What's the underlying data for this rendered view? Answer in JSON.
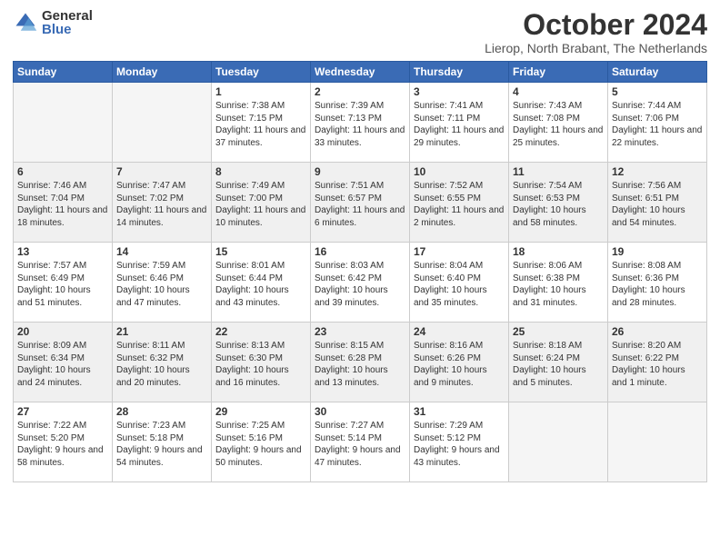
{
  "logo": {
    "general": "General",
    "blue": "Blue"
  },
  "header": {
    "month": "October 2024",
    "location": "Lierop, North Brabant, The Netherlands"
  },
  "days_of_week": [
    "Sunday",
    "Monday",
    "Tuesday",
    "Wednesday",
    "Thursday",
    "Friday",
    "Saturday"
  ],
  "weeks": [
    [
      {
        "num": "",
        "sunrise": "",
        "sunset": "",
        "daylight": "",
        "empty": true
      },
      {
        "num": "",
        "sunrise": "",
        "sunset": "",
        "daylight": "",
        "empty": true
      },
      {
        "num": "1",
        "sunrise": "Sunrise: 7:38 AM",
        "sunset": "Sunset: 7:15 PM",
        "daylight": "Daylight: 11 hours and 37 minutes.",
        "empty": false
      },
      {
        "num": "2",
        "sunrise": "Sunrise: 7:39 AM",
        "sunset": "Sunset: 7:13 PM",
        "daylight": "Daylight: 11 hours and 33 minutes.",
        "empty": false
      },
      {
        "num": "3",
        "sunrise": "Sunrise: 7:41 AM",
        "sunset": "Sunset: 7:11 PM",
        "daylight": "Daylight: 11 hours and 29 minutes.",
        "empty": false
      },
      {
        "num": "4",
        "sunrise": "Sunrise: 7:43 AM",
        "sunset": "Sunset: 7:08 PM",
        "daylight": "Daylight: 11 hours and 25 minutes.",
        "empty": false
      },
      {
        "num": "5",
        "sunrise": "Sunrise: 7:44 AM",
        "sunset": "Sunset: 7:06 PM",
        "daylight": "Daylight: 11 hours and 22 minutes.",
        "empty": false
      }
    ],
    [
      {
        "num": "6",
        "sunrise": "Sunrise: 7:46 AM",
        "sunset": "Sunset: 7:04 PM",
        "daylight": "Daylight: 11 hours and 18 minutes.",
        "empty": false
      },
      {
        "num": "7",
        "sunrise": "Sunrise: 7:47 AM",
        "sunset": "Sunset: 7:02 PM",
        "daylight": "Daylight: 11 hours and 14 minutes.",
        "empty": false
      },
      {
        "num": "8",
        "sunrise": "Sunrise: 7:49 AM",
        "sunset": "Sunset: 7:00 PM",
        "daylight": "Daylight: 11 hours and 10 minutes.",
        "empty": false
      },
      {
        "num": "9",
        "sunrise": "Sunrise: 7:51 AM",
        "sunset": "Sunset: 6:57 PM",
        "daylight": "Daylight: 11 hours and 6 minutes.",
        "empty": false
      },
      {
        "num": "10",
        "sunrise": "Sunrise: 7:52 AM",
        "sunset": "Sunset: 6:55 PM",
        "daylight": "Daylight: 11 hours and 2 minutes.",
        "empty": false
      },
      {
        "num": "11",
        "sunrise": "Sunrise: 7:54 AM",
        "sunset": "Sunset: 6:53 PM",
        "daylight": "Daylight: 10 hours and 58 minutes.",
        "empty": false
      },
      {
        "num": "12",
        "sunrise": "Sunrise: 7:56 AM",
        "sunset": "Sunset: 6:51 PM",
        "daylight": "Daylight: 10 hours and 54 minutes.",
        "empty": false
      }
    ],
    [
      {
        "num": "13",
        "sunrise": "Sunrise: 7:57 AM",
        "sunset": "Sunset: 6:49 PM",
        "daylight": "Daylight: 10 hours and 51 minutes.",
        "empty": false
      },
      {
        "num": "14",
        "sunrise": "Sunrise: 7:59 AM",
        "sunset": "Sunset: 6:46 PM",
        "daylight": "Daylight: 10 hours and 47 minutes.",
        "empty": false
      },
      {
        "num": "15",
        "sunrise": "Sunrise: 8:01 AM",
        "sunset": "Sunset: 6:44 PM",
        "daylight": "Daylight: 10 hours and 43 minutes.",
        "empty": false
      },
      {
        "num": "16",
        "sunrise": "Sunrise: 8:03 AM",
        "sunset": "Sunset: 6:42 PM",
        "daylight": "Daylight: 10 hours and 39 minutes.",
        "empty": false
      },
      {
        "num": "17",
        "sunrise": "Sunrise: 8:04 AM",
        "sunset": "Sunset: 6:40 PM",
        "daylight": "Daylight: 10 hours and 35 minutes.",
        "empty": false
      },
      {
        "num": "18",
        "sunrise": "Sunrise: 8:06 AM",
        "sunset": "Sunset: 6:38 PM",
        "daylight": "Daylight: 10 hours and 31 minutes.",
        "empty": false
      },
      {
        "num": "19",
        "sunrise": "Sunrise: 8:08 AM",
        "sunset": "Sunset: 6:36 PM",
        "daylight": "Daylight: 10 hours and 28 minutes.",
        "empty": false
      }
    ],
    [
      {
        "num": "20",
        "sunrise": "Sunrise: 8:09 AM",
        "sunset": "Sunset: 6:34 PM",
        "daylight": "Daylight: 10 hours and 24 minutes.",
        "empty": false
      },
      {
        "num": "21",
        "sunrise": "Sunrise: 8:11 AM",
        "sunset": "Sunset: 6:32 PM",
        "daylight": "Daylight: 10 hours and 20 minutes.",
        "empty": false
      },
      {
        "num": "22",
        "sunrise": "Sunrise: 8:13 AM",
        "sunset": "Sunset: 6:30 PM",
        "daylight": "Daylight: 10 hours and 16 minutes.",
        "empty": false
      },
      {
        "num": "23",
        "sunrise": "Sunrise: 8:15 AM",
        "sunset": "Sunset: 6:28 PM",
        "daylight": "Daylight: 10 hours and 13 minutes.",
        "empty": false
      },
      {
        "num": "24",
        "sunrise": "Sunrise: 8:16 AM",
        "sunset": "Sunset: 6:26 PM",
        "daylight": "Daylight: 10 hours and 9 minutes.",
        "empty": false
      },
      {
        "num": "25",
        "sunrise": "Sunrise: 8:18 AM",
        "sunset": "Sunset: 6:24 PM",
        "daylight": "Daylight: 10 hours and 5 minutes.",
        "empty": false
      },
      {
        "num": "26",
        "sunrise": "Sunrise: 8:20 AM",
        "sunset": "Sunset: 6:22 PM",
        "daylight": "Daylight: 10 hours and 1 minute.",
        "empty": false
      }
    ],
    [
      {
        "num": "27",
        "sunrise": "Sunrise: 7:22 AM",
        "sunset": "Sunset: 5:20 PM",
        "daylight": "Daylight: 9 hours and 58 minutes.",
        "empty": false
      },
      {
        "num": "28",
        "sunrise": "Sunrise: 7:23 AM",
        "sunset": "Sunset: 5:18 PM",
        "daylight": "Daylight: 9 hours and 54 minutes.",
        "empty": false
      },
      {
        "num": "29",
        "sunrise": "Sunrise: 7:25 AM",
        "sunset": "Sunset: 5:16 PM",
        "daylight": "Daylight: 9 hours and 50 minutes.",
        "empty": false
      },
      {
        "num": "30",
        "sunrise": "Sunrise: 7:27 AM",
        "sunset": "Sunset: 5:14 PM",
        "daylight": "Daylight: 9 hours and 47 minutes.",
        "empty": false
      },
      {
        "num": "31",
        "sunrise": "Sunrise: 7:29 AM",
        "sunset": "Sunset: 5:12 PM",
        "daylight": "Daylight: 9 hours and 43 minutes.",
        "empty": false
      },
      {
        "num": "",
        "sunrise": "",
        "sunset": "",
        "daylight": "",
        "empty": true
      },
      {
        "num": "",
        "sunrise": "",
        "sunset": "",
        "daylight": "",
        "empty": true
      }
    ]
  ]
}
